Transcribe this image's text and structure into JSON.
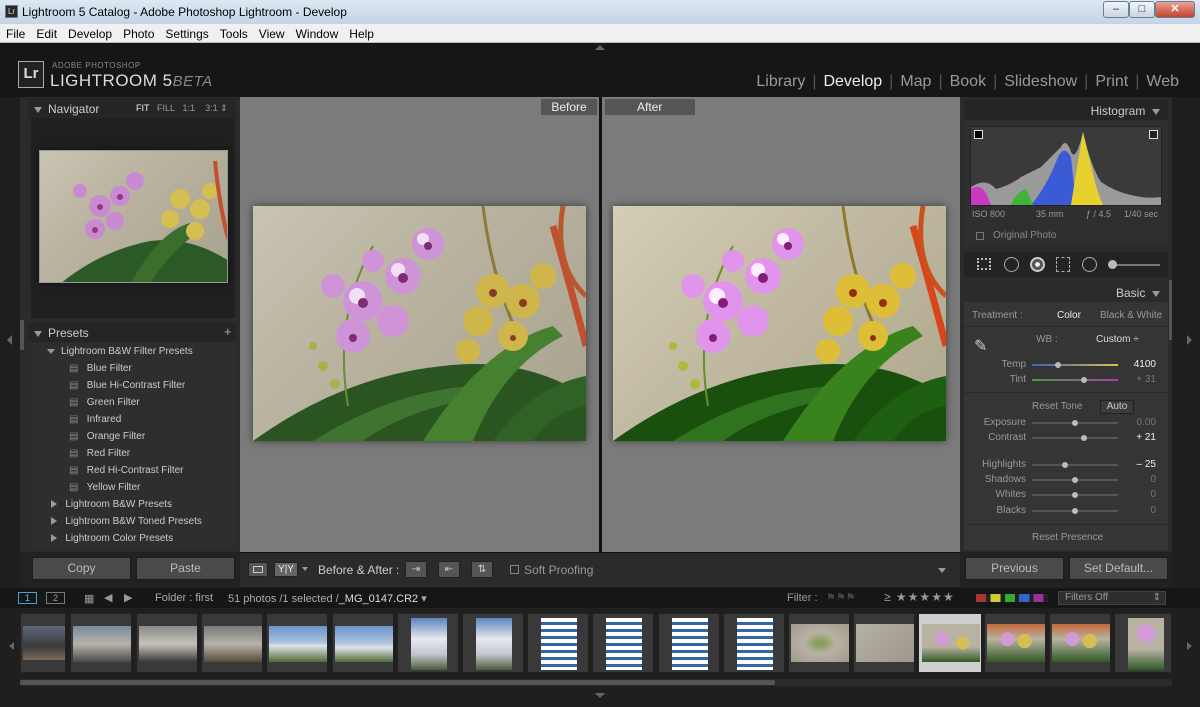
{
  "window": {
    "title": "Lightroom 5 Catalog - Adobe Photoshop Lightroom - Develop"
  },
  "menu": [
    "File",
    "Edit",
    "Develop",
    "Photo",
    "Settings",
    "Tools",
    "View",
    "Window",
    "Help"
  ],
  "brand": {
    "logo": "Lr",
    "line1": "ADOBE PHOTOSHOP",
    "line2": "LIGHTROOM 5",
    "beta": "BETA"
  },
  "modules": [
    "Library",
    "Develop",
    "Map",
    "Book",
    "Slideshow",
    "Print",
    "Web"
  ],
  "navigator": {
    "title": "Navigator",
    "zoom": [
      "FIT",
      "FILL",
      "1:1",
      "3:1"
    ]
  },
  "presets": {
    "title": "Presets",
    "add": "+",
    "folders": [
      "Lightroom B&W Filter Presets",
      "Lightroom B&W Presets",
      "Lightroom B&W Toned Presets",
      "Lightroom Color Presets"
    ],
    "items": [
      "Blue Filter",
      "Blue Hi-Contrast Filter",
      "Green Filter",
      "Infrared",
      "Orange Filter",
      "Red Filter",
      "Red Hi-Contrast Filter",
      "Yellow Filter"
    ]
  },
  "left_buttons": {
    "copy": "Copy",
    "paste": "Paste"
  },
  "compare": {
    "before": "Before",
    "after": "After"
  },
  "toolbar": {
    "before_after": "Before & After :",
    "soft_proofing": "Soft Proofing",
    "yy": "Y|Y"
  },
  "histogram": {
    "title": "Histogram",
    "iso": "ISO 800",
    "focal": "35 mm",
    "aperture": "ƒ / 4.5",
    "shutter": "1/40 sec",
    "original": "Original Photo"
  },
  "basic": {
    "title": "Basic",
    "treatment_label": "Treatment :",
    "color": "Color",
    "bw": "Black & White",
    "wb_label": "WB :",
    "wb_value": "Custom",
    "reset_tone": "Reset Tone",
    "auto": "Auto",
    "reset_presence": "Reset Presence",
    "sliders": [
      {
        "label": "Temp",
        "value": "4100",
        "pos": 0.3
      },
      {
        "label": "Tint",
        "value": "+ 31",
        "pos": 0.6
      },
      {
        "label": "Exposure",
        "value": "0.00",
        "pos": 0.5
      },
      {
        "label": "Contrast",
        "value": "+ 21",
        "pos": 0.6
      },
      {
        "label": "Highlights",
        "value": "– 25",
        "pos": 0.38
      },
      {
        "label": "Shadows",
        "value": "0",
        "pos": 0.5
      },
      {
        "label": "Whites",
        "value": "0",
        "pos": 0.5
      },
      {
        "label": "Blacks",
        "value": "0",
        "pos": 0.5
      }
    ]
  },
  "right_buttons": {
    "previous": "Previous",
    "set_default": "Set Default..."
  },
  "filmstrip": {
    "page1": "1",
    "page2": "2",
    "folder": "Folder : first",
    "count": "51 photos /1 selected /",
    "file": "_MG_0147.CR2",
    "filter_label": "Filter :",
    "filters_off": "Filters Off"
  },
  "colors": {
    "panel": "#2b2b2b",
    "center": "#7b7b7b",
    "accent": "#e8c531"
  }
}
